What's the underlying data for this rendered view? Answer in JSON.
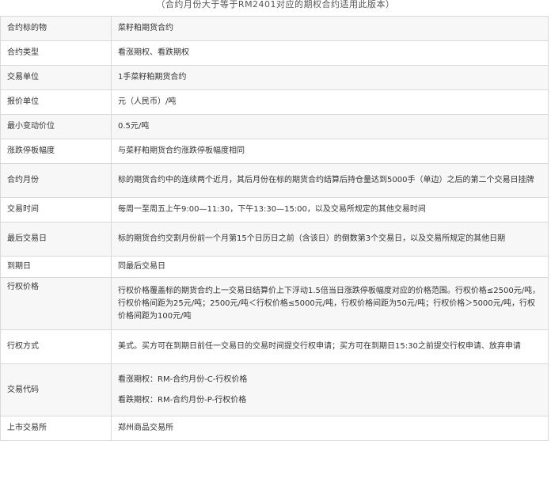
{
  "caption": "（合约月份大于等于RM2401对应的期权合约适用此版本）",
  "rows": [
    {
      "label": "合约标的物",
      "value": "菜籽粕期货合约"
    },
    {
      "label": "合约类型",
      "value": "看涨期权、看跌期权"
    },
    {
      "label": "交易单位",
      "value": "1手菜籽粕期货合约"
    },
    {
      "label": "报价单位",
      "value": "元（人民币）/吨"
    },
    {
      "label": "最小变动价位",
      "value": "0.5元/吨"
    },
    {
      "label": "涨跌停板幅度",
      "value": "与菜籽粕期货合约涨跌停板幅度相同"
    },
    {
      "label": "合约月份",
      "value": "标的期货合约中的连续两个近月，其后月份在标的期货合约结算后持仓量达到5000手（单边）之后的第二个交易日挂牌"
    },
    {
      "label": "交易时间",
      "value": "每周一至周五上午9:00—11:30，下午13:30—15:00，以及交易所规定的其他交易时间"
    },
    {
      "label": "最后交易日",
      "value": "标的期货合约交割月份前一个月第15个日历日之前（含该日）的倒数第3个交易日，以及交易所规定的其他日期"
    },
    {
      "label": "到期日",
      "value": "同最后交易日"
    },
    {
      "label": "行权价格",
      "value": "行权价格覆盖标的期货合约上一交易日结算价上下浮动1.5倍当日涨跌停板幅度对应的价格范围。行权价格≤2500元/吨，行权价格间距为25元/吨；2500元/吨＜行权价格≤5000元/吨，行权价格间距为50元/吨；行权价格＞5000元/吨，行权价格间距为100元/吨"
    },
    {
      "label": "行权方式",
      "value": "美式。买方可在到期日前任一交易日的交易时间提交行权申请；买方可在到期日15:30之前提交行权申请、放弃申请"
    },
    {
      "label": "交易代码",
      "call": "看涨期权：RM-合约月份-C-行权价格",
      "put": "看跌期权：RM-合约月份-P-行权价格"
    },
    {
      "label": "上市交易所",
      "value": "郑州商品交易所"
    }
  ]
}
